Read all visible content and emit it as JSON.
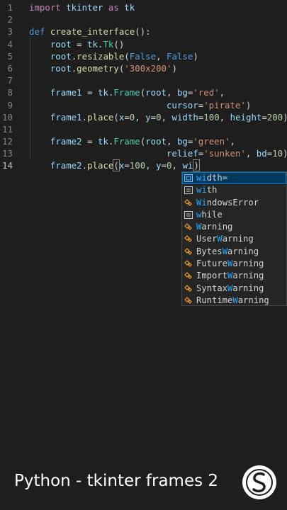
{
  "editor": {
    "current_line": 14,
    "lines": [
      {
        "n": "1",
        "tokens": [
          {
            "t": "import",
            "c": "k"
          },
          {
            "t": " tkinter ",
            "c": "v"
          },
          {
            "t": "as",
            "c": "k"
          },
          {
            "t": " tk",
            "c": "v"
          }
        ]
      },
      {
        "n": "2",
        "tokens": []
      },
      {
        "n": "3",
        "tokens": [
          {
            "t": "def",
            "c": "kd"
          },
          {
            "t": " ",
            "c": "p"
          },
          {
            "t": "create_interface",
            "c": "fn"
          },
          {
            "t": "():",
            "c": "p"
          }
        ]
      },
      {
        "n": "4",
        "tokens": [
          {
            "t": "    root",
            "c": "v"
          },
          {
            "t": " = ",
            "c": "p"
          },
          {
            "t": "tk",
            "c": "v"
          },
          {
            "t": ".",
            "c": "p"
          },
          {
            "t": "Tk",
            "c": "cl"
          },
          {
            "t": "()",
            "c": "p"
          }
        ]
      },
      {
        "n": "5",
        "tokens": [
          {
            "t": "    root",
            "c": "v"
          },
          {
            "t": ".",
            "c": "p"
          },
          {
            "t": "resizable",
            "c": "fn"
          },
          {
            "t": "(",
            "c": "p"
          },
          {
            "t": "False",
            "c": "b"
          },
          {
            "t": ", ",
            "c": "p"
          },
          {
            "t": "False",
            "c": "b"
          },
          {
            "t": ")",
            "c": "p"
          }
        ]
      },
      {
        "n": "6",
        "tokens": [
          {
            "t": "    root",
            "c": "v"
          },
          {
            "t": ".",
            "c": "p"
          },
          {
            "t": "geometry",
            "c": "fn"
          },
          {
            "t": "(",
            "c": "p"
          },
          {
            "t": "'300x200'",
            "c": "s"
          },
          {
            "t": ")",
            "c": "p"
          }
        ]
      },
      {
        "n": "7",
        "tokens": []
      },
      {
        "n": "8",
        "tokens": [
          {
            "t": "    frame1",
            "c": "v"
          },
          {
            "t": " = ",
            "c": "p"
          },
          {
            "t": "tk",
            "c": "v"
          },
          {
            "t": ".",
            "c": "p"
          },
          {
            "t": "Frame",
            "c": "cl"
          },
          {
            "t": "(",
            "c": "p"
          },
          {
            "t": "root",
            "c": "v"
          },
          {
            "t": ", ",
            "c": "p"
          },
          {
            "t": "bg",
            "c": "v"
          },
          {
            "t": "=",
            "c": "p"
          },
          {
            "t": "'red'",
            "c": "s"
          },
          {
            "t": ",",
            "c": "p"
          }
        ]
      },
      {
        "n": "9",
        "tokens": [
          {
            "t": "                          cursor",
            "c": "v"
          },
          {
            "t": "=",
            "c": "p"
          },
          {
            "t": "'pirate'",
            "c": "s"
          },
          {
            "t": ")",
            "c": "p"
          }
        ]
      },
      {
        "n": "10",
        "tokens": [
          {
            "t": "    frame1",
            "c": "v"
          },
          {
            "t": ".",
            "c": "p"
          },
          {
            "t": "place",
            "c": "fn"
          },
          {
            "t": "(",
            "c": "p"
          },
          {
            "t": "x",
            "c": "v"
          },
          {
            "t": "=",
            "c": "p"
          },
          {
            "t": "0",
            "c": "n"
          },
          {
            "t": ", ",
            "c": "p"
          },
          {
            "t": "y",
            "c": "v"
          },
          {
            "t": "=",
            "c": "p"
          },
          {
            "t": "0",
            "c": "n"
          },
          {
            "t": ", ",
            "c": "p"
          },
          {
            "t": "width",
            "c": "v"
          },
          {
            "t": "=",
            "c": "p"
          },
          {
            "t": "100",
            "c": "n"
          },
          {
            "t": ", ",
            "c": "p"
          },
          {
            "t": "height",
            "c": "v"
          },
          {
            "t": "=",
            "c": "p"
          },
          {
            "t": "200",
            "c": "n"
          },
          {
            "t": ")",
            "c": "p"
          }
        ]
      },
      {
        "n": "11",
        "tokens": []
      },
      {
        "n": "12",
        "tokens": [
          {
            "t": "    frame2",
            "c": "v"
          },
          {
            "t": " = ",
            "c": "p"
          },
          {
            "t": "tk",
            "c": "v"
          },
          {
            "t": ".",
            "c": "p"
          },
          {
            "t": "Frame",
            "c": "cl"
          },
          {
            "t": "(",
            "c": "p"
          },
          {
            "t": "root",
            "c": "v"
          },
          {
            "t": ", ",
            "c": "p"
          },
          {
            "t": "bg",
            "c": "v"
          },
          {
            "t": "=",
            "c": "p"
          },
          {
            "t": "'green'",
            "c": "s"
          },
          {
            "t": ",",
            "c": "p"
          }
        ]
      },
      {
        "n": "13",
        "tokens": [
          {
            "t": "                          relief",
            "c": "v"
          },
          {
            "t": "=",
            "c": "p"
          },
          {
            "t": "'sunken'",
            "c": "s"
          },
          {
            "t": ", ",
            "c": "p"
          },
          {
            "t": "bd",
            "c": "v"
          },
          {
            "t": "=",
            "c": "p"
          },
          {
            "t": "10",
            "c": "n"
          },
          {
            "t": ")",
            "c": "p"
          }
        ]
      },
      {
        "n": "14",
        "tokens": [
          {
            "t": "    frame2",
            "c": "v"
          },
          {
            "t": ".",
            "c": "p"
          },
          {
            "t": "place",
            "c": "fn"
          },
          {
            "t": "(",
            "c": "p",
            "box": true
          },
          {
            "t": "x",
            "c": "v"
          },
          {
            "t": "=",
            "c": "p"
          },
          {
            "t": "100",
            "c": "n"
          },
          {
            "t": ", ",
            "c": "p"
          },
          {
            "t": "y",
            "c": "v"
          },
          {
            "t": "=",
            "c": "p"
          },
          {
            "t": "0",
            "c": "n"
          },
          {
            "t": ", ",
            "c": "p"
          },
          {
            "t": "wi",
            "c": "v"
          },
          {
            "t": "",
            "c": "p",
            "cursor": true
          },
          {
            "t": ")",
            "c": "p",
            "box": true
          }
        ]
      }
    ]
  },
  "suggestions": {
    "selected_index": 0,
    "items": [
      {
        "pre": "",
        "match": "wi",
        "post": "dth=",
        "icon": "variable-icon"
      },
      {
        "pre": "",
        "match": "wi",
        "post": "th",
        "icon": "keyword-icon"
      },
      {
        "pre": "",
        "match": "Wi",
        "post": "ndowsError",
        "icon": "class-icon"
      },
      {
        "pre": "",
        "match": "w",
        "post": "hile",
        "icon": "keyword-icon"
      },
      {
        "pre": "",
        "match": "W",
        "post": "arning",
        "icon": "class-icon"
      },
      {
        "pre": "User",
        "match": "W",
        "post": "arning",
        "icon": "class-icon"
      },
      {
        "pre": "Bytes",
        "match": "W",
        "post": "arning",
        "icon": "class-icon"
      },
      {
        "pre": "Future",
        "match": "W",
        "post": "arning",
        "icon": "class-icon"
      },
      {
        "pre": "Import",
        "match": "W",
        "post": "arning",
        "icon": "class-icon"
      },
      {
        "pre": "Syntax",
        "match": "W",
        "post": "arning",
        "icon": "class-icon"
      },
      {
        "pre": "Runtime",
        "match": "W",
        "post": "arning",
        "icon": "class-icon"
      }
    ]
  },
  "caption": {
    "title": "Python - tkinter frames 2",
    "logo": "brand-logo-s"
  },
  "colors": {
    "background": "#1e1e1e",
    "keyword": "#c586c0",
    "string": "#ce9178",
    "number": "#b5cea8",
    "class": "#4ec9b0",
    "function": "#dcdcaa",
    "variable": "#9cdcfe",
    "match_highlight": "#2aaaff",
    "icon_blue": "#75beff",
    "icon_orange": "#ee9d28"
  }
}
